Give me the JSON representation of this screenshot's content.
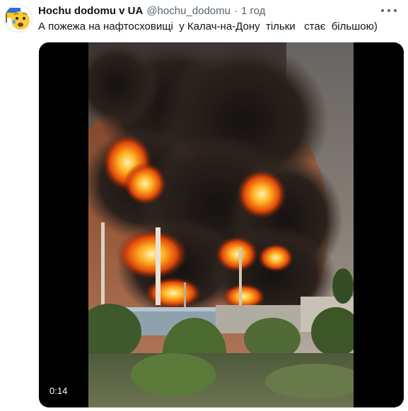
{
  "tweet": {
    "author_name": "Hochu dodomu v UA",
    "author_handle": "@hochu_dodomu",
    "separator": "·",
    "time": "1 год",
    "text": "А пожежа на нафтосховищі  у Калач-на-Дону  тільки   стає  більшою)",
    "more_icon": "more-horizontal-icon",
    "avatar_icon": "emoji-face-with-ukraine-flag"
  },
  "media": {
    "type": "video",
    "duration": "0:14",
    "content": "oil-depot-fire-smoke"
  },
  "colors": {
    "name": "#0f1419",
    "secondary": "#536471",
    "media_bg": "#000000"
  }
}
